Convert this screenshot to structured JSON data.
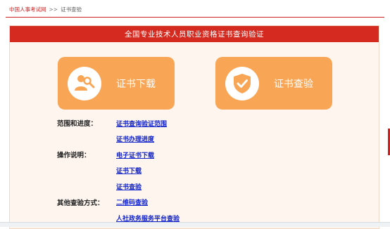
{
  "breadcrumb": {
    "home": "中国人事考试网",
    "separator": ">>",
    "current": "证书查验"
  },
  "panel": {
    "title": "全国专业技术人员职业资格证书查询验证",
    "buttons": [
      {
        "label": "证书下载",
        "icon": "people-search-icon"
      },
      {
        "label": "证书查验",
        "icon": "shield-check-icon"
      }
    ],
    "sections": [
      {
        "key": "范围和进度：",
        "links": [
          "证书查询验证范围",
          "证书办理进度"
        ]
      },
      {
        "key": "操作说明：",
        "links": [
          "电子证书下载",
          "证书下载",
          "证书查验"
        ]
      },
      {
        "key": "其他查验方式：",
        "links": [
          "二维码查验",
          "人社政务服务平台查验"
        ]
      }
    ]
  },
  "colors": {
    "header_red": "#d52a20",
    "button_orange": "#f8a656",
    "panel_bg": "#fdf5ee",
    "link_blue": "#1122cc"
  }
}
